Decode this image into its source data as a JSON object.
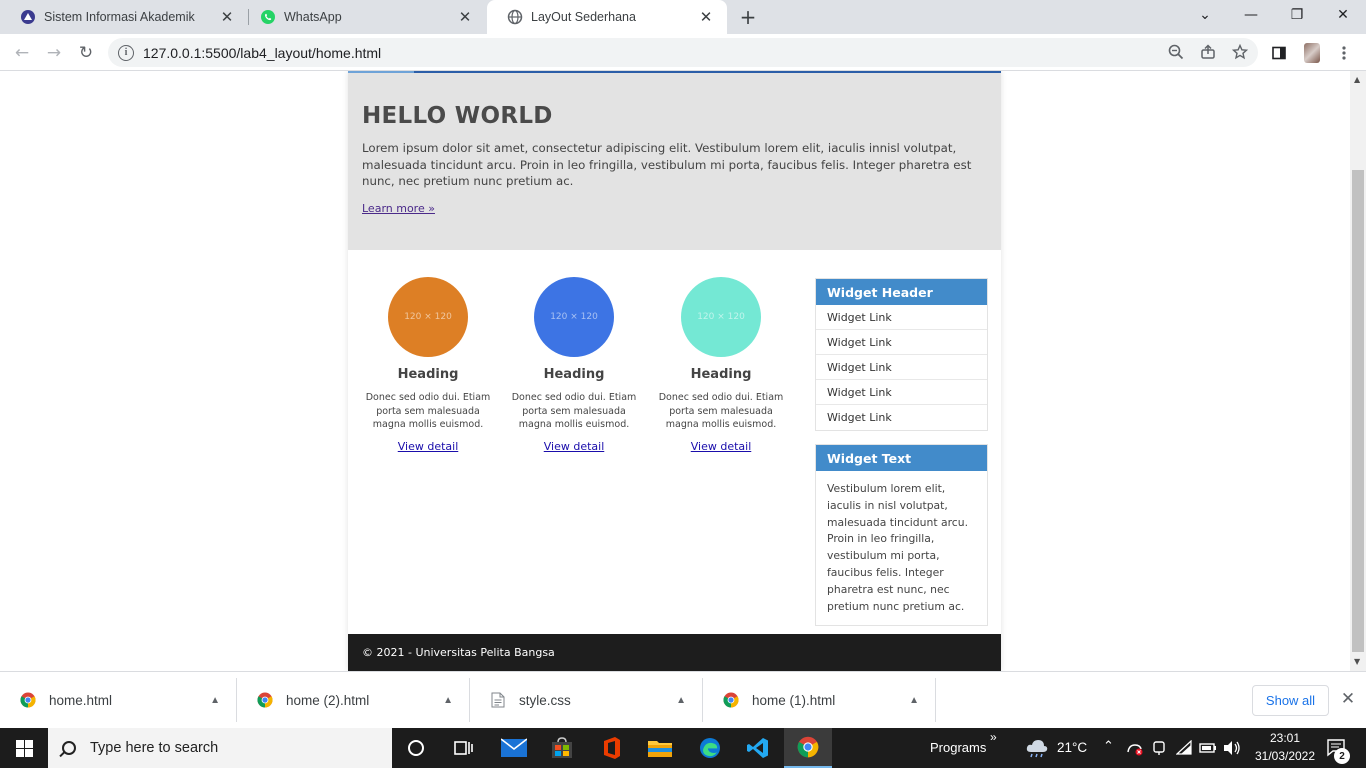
{
  "browser": {
    "tabs": [
      {
        "title": "Sistem Informasi Akademik",
        "close": "✕"
      },
      {
        "title": "WhatsApp",
        "close": "✕"
      },
      {
        "title": "LayOut Sederhana",
        "close": "✕"
      }
    ],
    "new_tab": "+",
    "window_controls": {
      "dropdown": "⌄",
      "minimize": "—",
      "restore": "❐",
      "close": "✕"
    },
    "nav": {
      "back": "←",
      "forward": "→",
      "reload": "↻"
    },
    "url": "127.0.0.1:5500/lab4_layout/home.html"
  },
  "page": {
    "hero": {
      "title": "HELLO WORLD",
      "text": "Lorem ipsum dolor sit amet, consectetur adipiscing elit. Vestibulum lorem elit, iaculis innisl volutpat, malesuada tincidunt arcu. Proin in leo fringilla, vestibulum mi porta, faucibus felis. Integer pharetra est nunc, nec pretium nunc pretium ac.",
      "link": "Learn more »"
    },
    "cards": [
      {
        "placeholder": "120 × 120",
        "color": "#dd7f25",
        "heading": "Heading",
        "text": "Donec sed odio dui. Etiam porta sem malesuada magna mollis euismod.",
        "link": "View detail"
      },
      {
        "placeholder": "120 × 120",
        "color": "#3d74e4",
        "heading": "Heading",
        "text": "Donec sed odio dui. Etiam porta sem malesuada magna mollis euismod.",
        "link": "View detail"
      },
      {
        "placeholder": "120 × 120",
        "color": "#74e8d4",
        "heading": "Heading",
        "text": "Donec sed odio dui. Etiam porta sem malesuada magna mollis euismod.",
        "link": "View detail"
      }
    ],
    "widget_links": {
      "header": "Widget Header",
      "items": [
        "Widget Link",
        "Widget Link",
        "Widget Link",
        "Widget Link",
        "Widget Link"
      ]
    },
    "widget_text": {
      "header": "Widget Text",
      "text": "Vestibulum lorem elit, iaculis in nisl volutpat, malesuada tincidunt arcu. Proin in leo fringilla, vestibulum mi porta, faucibus felis. Integer pharetra est nunc, nec pretium nunc pretium ac."
    },
    "footer": "© 2021 - Universitas Pelita Bangsa"
  },
  "downloads": {
    "items": [
      {
        "name": "home.html",
        "icon": "chrome-icon"
      },
      {
        "name": "home (2).html",
        "icon": "chrome-icon"
      },
      {
        "name": "style.css",
        "icon": "file-icon"
      },
      {
        "name": "home (1).html",
        "icon": "chrome-icon"
      }
    ],
    "show_all": "Show all",
    "close": "✕"
  },
  "taskbar": {
    "search_placeholder": "Type here to search",
    "programs": "Programs",
    "programs_chevron": "»",
    "temperature": "21°C",
    "time": "23:01",
    "date": "31/03/2022",
    "notifications": "2"
  },
  "colors": {
    "accent": "#428bca",
    "nav_edge": "#2b5ea8",
    "footer": "#1d1d1d",
    "hero_bg": "#e3e3e3"
  }
}
